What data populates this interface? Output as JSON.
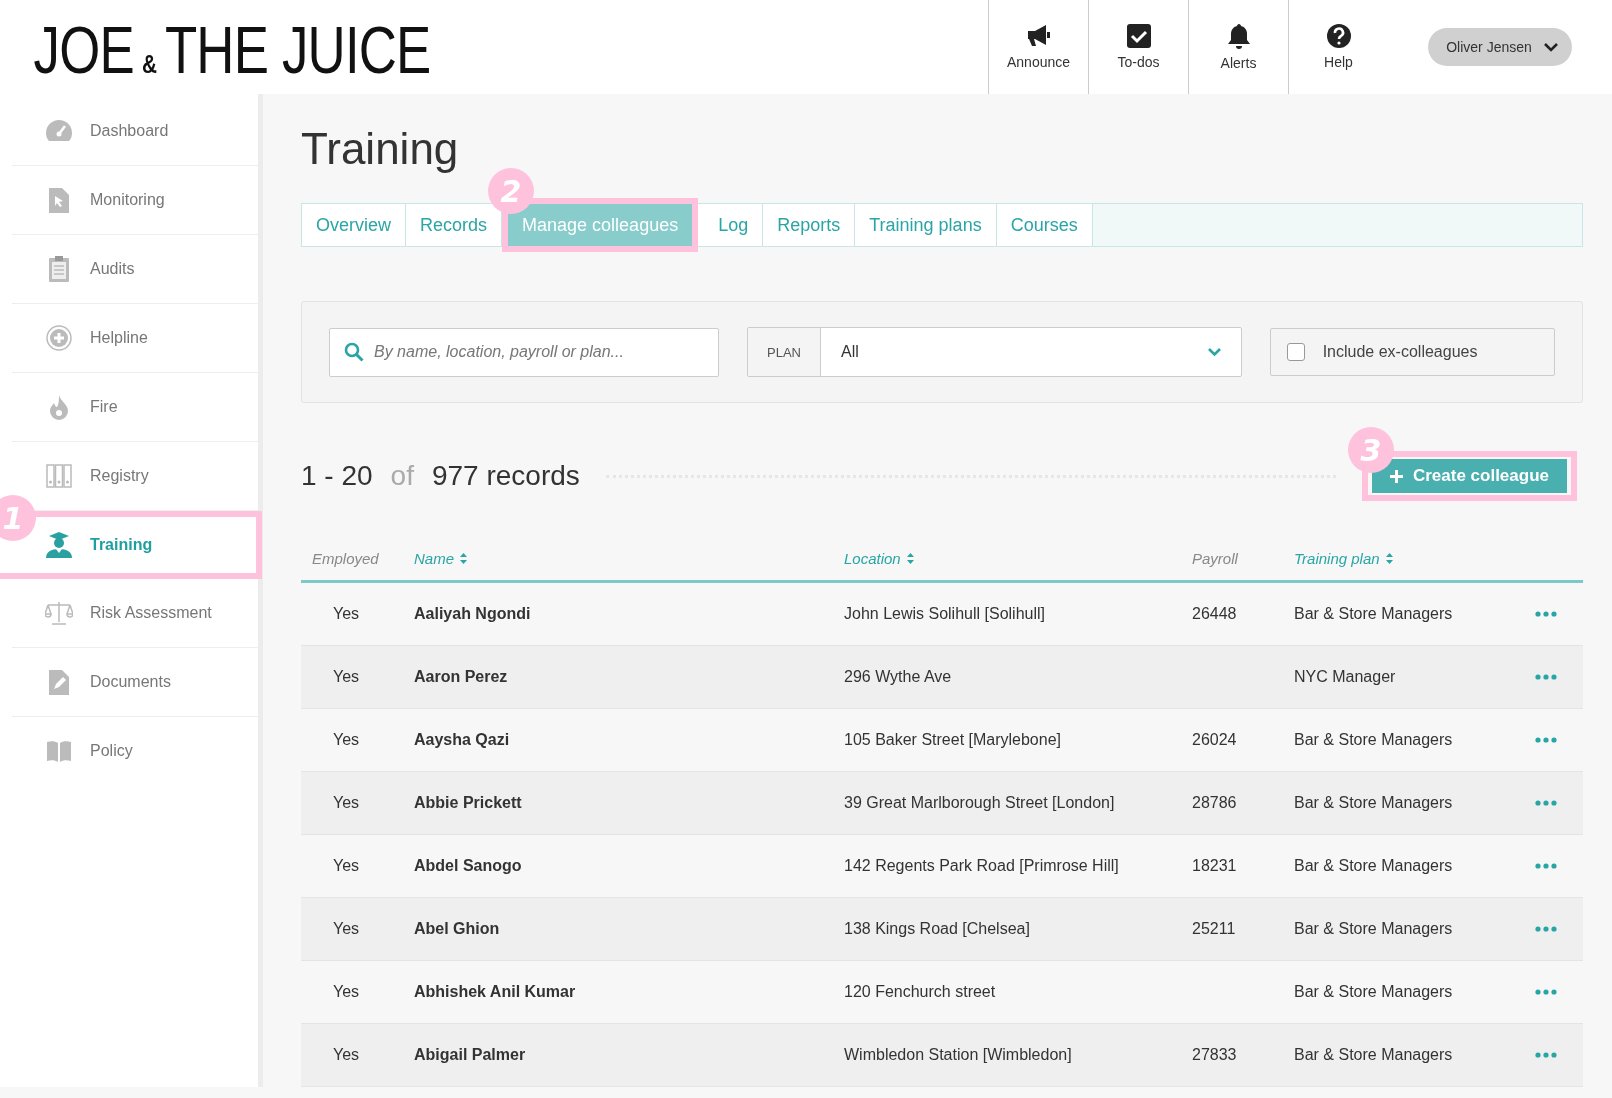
{
  "logo": {
    "parts": [
      "JOE",
      "&",
      "THE JUICE"
    ]
  },
  "header_actions": [
    {
      "label": "Announce"
    },
    {
      "label": "To-dos"
    },
    {
      "label": "Alerts"
    },
    {
      "label": "Help"
    }
  ],
  "user_menu": {
    "label": "Oliver Jensen"
  },
  "sidebar": {
    "items": [
      {
        "label": "Dashboard",
        "selected": false
      },
      {
        "label": "Monitoring",
        "selected": false
      },
      {
        "label": "Audits",
        "selected": false
      },
      {
        "label": "Helpline",
        "selected": false
      },
      {
        "label": "Fire",
        "selected": false
      },
      {
        "label": "Registry",
        "selected": false
      },
      {
        "label": "Training",
        "selected": true,
        "annotation": "1"
      },
      {
        "label": "Risk Assessment",
        "selected": false
      },
      {
        "label": "Documents",
        "selected": false
      },
      {
        "label": "Policy",
        "selected": false
      }
    ]
  },
  "page_title": "Training",
  "tabs": [
    {
      "label": "Overview",
      "selected": false
    },
    {
      "label": "Records",
      "selected": false
    },
    {
      "label": "Manage colleagues",
      "selected": true,
      "annotation": "2"
    },
    {
      "label": "Log",
      "selected": false
    },
    {
      "label": "Reports",
      "selected": false
    },
    {
      "label": "Training plans",
      "selected": false
    },
    {
      "label": "Courses",
      "selected": false
    }
  ],
  "filters": {
    "search": {
      "placeholder": "By name, location, payroll or plan..."
    },
    "plan": {
      "label": "PLAN",
      "value": "All"
    },
    "include_ex_colleagues": {
      "label": "Include ex-colleagues",
      "checked": false
    }
  },
  "records": {
    "range": "1 - 20",
    "of": "of",
    "total": "977 records"
  },
  "create_button": {
    "label": "Create colleague",
    "annotation": "3"
  },
  "table": {
    "columns": [
      {
        "label": "Employed",
        "sortable": false
      },
      {
        "label": "Name",
        "sortable": true
      },
      {
        "label": "Location",
        "sortable": true
      },
      {
        "label": "Payroll",
        "sortable": false
      },
      {
        "label": "Training plan",
        "sortable": true
      }
    ],
    "rows": [
      {
        "employed": "Yes",
        "name": "Aaliyah Ngondi",
        "location": "John Lewis Solihull [Solihull]",
        "payroll": "26448",
        "plan": "Bar & Store Managers"
      },
      {
        "employed": "Yes",
        "name": "Aaron Perez",
        "location": "296 Wythe Ave",
        "plan": "NYC Manager"
      },
      {
        "employed": "Yes",
        "name": "Aaysha Qazi",
        "location": "105 Baker Street [Marylebone]",
        "payroll": "26024",
        "plan": "Bar & Store Managers"
      },
      {
        "employed": "Yes",
        "name": "Abbie Prickett",
        "location": "39 Great Marlborough Street [London]",
        "payroll": "28786",
        "plan": "Bar & Store Managers"
      },
      {
        "employed": "Yes",
        "name": "Abdel Sanogo",
        "location": "142 Regents Park Road [Primrose Hill]",
        "payroll": "18231",
        "plan": "Bar & Store Managers"
      },
      {
        "employed": "Yes",
        "name": "Abel Ghion",
        "location": "138 Kings Road [Chelsea]",
        "payroll": "25211",
        "plan": "Bar & Store Managers"
      },
      {
        "employed": "Yes",
        "name": "Abhishek Anil Kumar",
        "location": "120 Fenchurch street",
        "plan": "Bar & Store Managers"
      },
      {
        "employed": "Yes",
        "name": "Abigail Palmer",
        "location": "Wimbledon Station [Wimbledon]",
        "payroll": "27833",
        "plan": "Bar & Store Managers"
      }
    ]
  }
}
